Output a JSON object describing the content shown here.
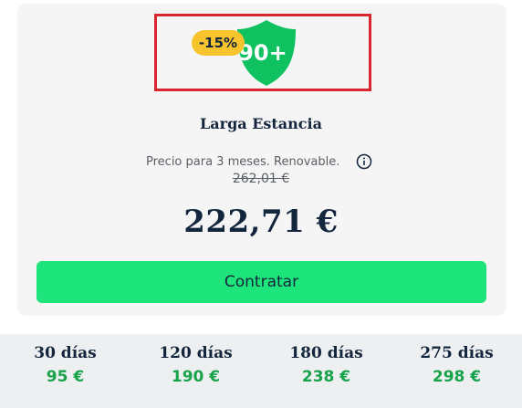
{
  "offer": {
    "discount_badge": "-15%",
    "shield_text": "90+",
    "title": "Larga Estancia",
    "price_note": "Precio para 3 meses. Renovable.",
    "old_price": "262,01 €",
    "price": "222,71 €",
    "cta_label": "Contratar"
  },
  "plans": [
    {
      "days": "30 días",
      "price": "95 €"
    },
    {
      "days": "120 días",
      "price": "190 €"
    },
    {
      "days": "180 días",
      "price": "238 €"
    },
    {
      "days": "275 días",
      "price": "298 €"
    }
  ],
  "colors": {
    "accent_green": "#1ee57b",
    "shield_green": "#10c25f",
    "badge_yellow": "#f7c42e",
    "price_green": "#16a34a",
    "highlight_red": "#d8262f",
    "text_dark": "#14263d"
  },
  "icons": {
    "shield": "shield-icon",
    "info": "info-icon"
  }
}
